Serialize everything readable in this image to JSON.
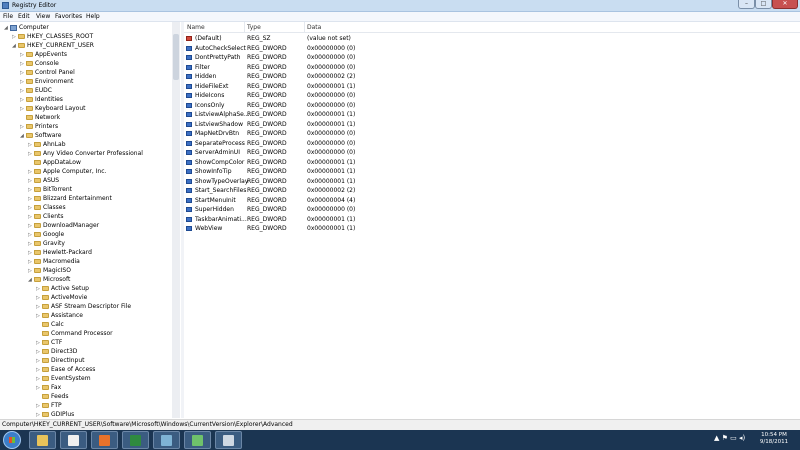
{
  "window": {
    "title": "Registry Editor",
    "controls": {
      "minimize": "–",
      "maximize": "□",
      "close": "✕"
    }
  },
  "menu": [
    "File",
    "Edit",
    "View",
    "Favorites",
    "Help"
  ],
  "tree": [
    {
      "label": "Computer",
      "level": 0,
      "state": "expanded",
      "icon": "computer-icon"
    },
    {
      "label": "HKEY_CLASSES_ROOT",
      "level": 1,
      "state": "collapsed"
    },
    {
      "label": "HKEY_CURRENT_USER",
      "level": 1,
      "state": "expanded"
    },
    {
      "label": "AppEvents",
      "level": 2,
      "state": "collapsed"
    },
    {
      "label": "Console",
      "level": 2,
      "state": "collapsed"
    },
    {
      "label": "Control Panel",
      "level": 2,
      "state": "collapsed"
    },
    {
      "label": "Environment",
      "level": 2,
      "state": "collapsed"
    },
    {
      "label": "EUDC",
      "level": 2,
      "state": "collapsed"
    },
    {
      "label": "Identities",
      "level": 2,
      "state": "collapsed"
    },
    {
      "label": "Keyboard Layout",
      "level": 2,
      "state": "collapsed"
    },
    {
      "label": "Network",
      "level": 2,
      "state": "none"
    },
    {
      "label": "Printers",
      "level": 2,
      "state": "collapsed"
    },
    {
      "label": "Software",
      "level": 2,
      "state": "expanded"
    },
    {
      "label": "AhnLab",
      "level": 3,
      "state": "collapsed"
    },
    {
      "label": "Any Video Converter Professional",
      "level": 3,
      "state": "collapsed"
    },
    {
      "label": "AppDataLow",
      "level": 3,
      "state": "none"
    },
    {
      "label": "Apple Computer, Inc.",
      "level": 3,
      "state": "collapsed"
    },
    {
      "label": "ASUS",
      "level": 3,
      "state": "collapsed"
    },
    {
      "label": "BitTorrent",
      "level": 3,
      "state": "collapsed"
    },
    {
      "label": "Blizzard Entertainment",
      "level": 3,
      "state": "collapsed"
    },
    {
      "label": "Classes",
      "level": 3,
      "state": "collapsed"
    },
    {
      "label": "Clients",
      "level": 3,
      "state": "collapsed"
    },
    {
      "label": "DownloadManager",
      "level": 3,
      "state": "collapsed"
    },
    {
      "label": "Google",
      "level": 3,
      "state": "collapsed"
    },
    {
      "label": "Gravity",
      "level": 3,
      "state": "collapsed"
    },
    {
      "label": "Hewlett-Packard",
      "level": 3,
      "state": "collapsed"
    },
    {
      "label": "Macromedia",
      "level": 3,
      "state": "collapsed"
    },
    {
      "label": "MagicISO",
      "level": 3,
      "state": "collapsed"
    },
    {
      "label": "Microsoft",
      "level": 3,
      "state": "expanded"
    },
    {
      "label": "Active Setup",
      "level": 4,
      "state": "collapsed"
    },
    {
      "label": "ActiveMovie",
      "level": 4,
      "state": "collapsed"
    },
    {
      "label": "ASF Stream Descriptor File",
      "level": 4,
      "state": "collapsed"
    },
    {
      "label": "Assistance",
      "level": 4,
      "state": "collapsed"
    },
    {
      "label": "Calc",
      "level": 4,
      "state": "none"
    },
    {
      "label": "Command Processor",
      "level": 4,
      "state": "none"
    },
    {
      "label": "CTF",
      "level": 4,
      "state": "collapsed"
    },
    {
      "label": "Direct3D",
      "level": 4,
      "state": "collapsed"
    },
    {
      "label": "DirectInput",
      "level": 4,
      "state": "collapsed"
    },
    {
      "label": "Ease of Access",
      "level": 4,
      "state": "collapsed"
    },
    {
      "label": "EventSystem",
      "level": 4,
      "state": "collapsed"
    },
    {
      "label": "Fax",
      "level": 4,
      "state": "collapsed"
    },
    {
      "label": "Feeds",
      "level": 4,
      "state": "none"
    },
    {
      "label": "FTP",
      "level": 4,
      "state": "collapsed"
    },
    {
      "label": "GDIPlus",
      "level": 4,
      "state": "collapsed"
    }
  ],
  "columns": {
    "name": "Name",
    "type": "Type",
    "data": "Data"
  },
  "values": [
    {
      "name": "(Default)",
      "type": "REG_SZ",
      "data": "(value not set)",
      "kind": "sz"
    },
    {
      "name": "AutoCheckSelect",
      "type": "REG_DWORD",
      "data": "0x00000000 (0)",
      "kind": "dword"
    },
    {
      "name": "DontPrettyPath",
      "type": "REG_DWORD",
      "data": "0x00000000 (0)",
      "kind": "dword"
    },
    {
      "name": "Filter",
      "type": "REG_DWORD",
      "data": "0x00000000 (0)",
      "kind": "dword"
    },
    {
      "name": "Hidden",
      "type": "REG_DWORD",
      "data": "0x00000002 (2)",
      "kind": "dword"
    },
    {
      "name": "HideFileExt",
      "type": "REG_DWORD",
      "data": "0x00000001 (1)",
      "kind": "dword"
    },
    {
      "name": "HideIcons",
      "type": "REG_DWORD",
      "data": "0x00000000 (0)",
      "kind": "dword"
    },
    {
      "name": "IconsOnly",
      "type": "REG_DWORD",
      "data": "0x00000000 (0)",
      "kind": "dword"
    },
    {
      "name": "ListviewAlphaSe...",
      "type": "REG_DWORD",
      "data": "0x00000001 (1)",
      "kind": "dword"
    },
    {
      "name": "ListviewShadow",
      "type": "REG_DWORD",
      "data": "0x00000001 (1)",
      "kind": "dword"
    },
    {
      "name": "MapNetDrvBtn",
      "type": "REG_DWORD",
      "data": "0x00000000 (0)",
      "kind": "dword"
    },
    {
      "name": "SeparateProcess",
      "type": "REG_DWORD",
      "data": "0x00000000 (0)",
      "kind": "dword"
    },
    {
      "name": "ServerAdminUI",
      "type": "REG_DWORD",
      "data": "0x00000000 (0)",
      "kind": "dword"
    },
    {
      "name": "ShowCompColor",
      "type": "REG_DWORD",
      "data": "0x00000001 (1)",
      "kind": "dword"
    },
    {
      "name": "ShowInfoTip",
      "type": "REG_DWORD",
      "data": "0x00000001 (1)",
      "kind": "dword"
    },
    {
      "name": "ShowTypeOverlay",
      "type": "REG_DWORD",
      "data": "0x00000001 (1)",
      "kind": "dword"
    },
    {
      "name": "Start_SearchFiles",
      "type": "REG_DWORD",
      "data": "0x00000002 (2)",
      "kind": "dword"
    },
    {
      "name": "StartMenuInit",
      "type": "REG_DWORD",
      "data": "0x00000004 (4)",
      "kind": "dword"
    },
    {
      "name": "SuperHidden",
      "type": "REG_DWORD",
      "data": "0x00000000 (0)",
      "kind": "dword"
    },
    {
      "name": "TaskbarAnimati...",
      "type": "REG_DWORD",
      "data": "0x00000001 (1)",
      "kind": "dword"
    },
    {
      "name": "WebView",
      "type": "REG_DWORD",
      "data": "0x00000001 (1)",
      "kind": "dword"
    }
  ],
  "status": "Computer\\HKEY_CURRENT_USER\\Software\\Microsoft\\Windows\\CurrentVersion\\Explorer\\Advanced",
  "taskbar": {
    "buttons": [
      {
        "name": "explorer-icon",
        "color": "#e8c35a"
      },
      {
        "name": "media-player-icon",
        "color": "#f0f0f0"
      },
      {
        "name": "firefox-icon",
        "color": "#e8722a"
      },
      {
        "name": "excel-icon",
        "color": "#2f8a3f"
      },
      {
        "name": "document-icon",
        "color": "#7fb3d5"
      },
      {
        "name": "app-icon",
        "color": "#6fc26b"
      },
      {
        "name": "regedit-icon",
        "color": "#cfd8e3"
      }
    ],
    "tray": "▲ ⚑ ▭ ◂)",
    "time": "10:54 PM",
    "date": "9/18/2011"
  }
}
